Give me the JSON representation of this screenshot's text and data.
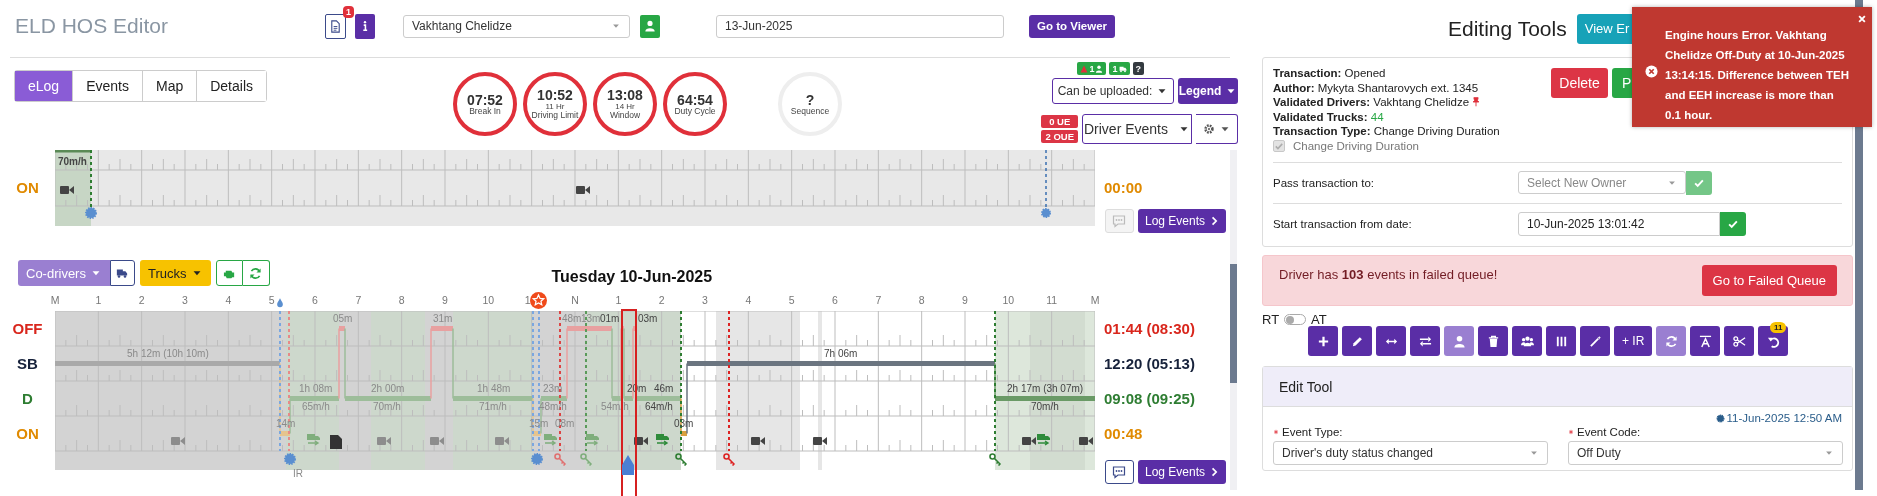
{
  "header": {
    "title": "ELD HOS Editor",
    "doc_badge": "1",
    "driver_select": "Vakhtang Chelidze",
    "date_field": "13-Jun-2025",
    "viewer_button": "Go to Viewer"
  },
  "tabs": [
    {
      "label": "eLog",
      "selected": true
    },
    {
      "label": "Events",
      "selected": false
    },
    {
      "label": "Map",
      "selected": false
    },
    {
      "label": "Details",
      "selected": false
    }
  ],
  "timers": [
    {
      "value": "07:52",
      "label": "Break In",
      "kind": "violation"
    },
    {
      "value": "10:52",
      "caption": "11 Hr",
      "label": "Driving Limit",
      "kind": "violation"
    },
    {
      "value": "13:08",
      "caption": "14 Hr",
      "label": "Window",
      "kind": "violation"
    },
    {
      "value": "64:54",
      "label": "Duty Cycle",
      "kind": "violation"
    },
    {
      "value": "?",
      "label": "Sequence",
      "kind": "pending"
    }
  ],
  "upload": {
    "badges": [
      {
        "text": "1",
        "kind": "driver"
      },
      {
        "text": "1",
        "kind": "truck"
      },
      {
        "text": "?",
        "kind": "help"
      }
    ],
    "dropdown": "Can be uploaded:",
    "legend_button": "Legend"
  },
  "ue_badges": [
    "0 UE",
    "2 OUE"
  ],
  "events_dropdown": "Driver Events",
  "previous_day": {
    "row_label": "ON",
    "speed_label": "70m/h",
    "total": "00:00",
    "log_button": "Log Events",
    "comment_disabled": true
  },
  "day": {
    "toolbar": {
      "codrivers": "Co-drivers",
      "trucks": "Trucks"
    },
    "title": "Tuesday 10-Jun-2025",
    "hours": [
      "M",
      "1",
      "2",
      "3",
      "4",
      "5",
      "6",
      "7",
      "8",
      "9",
      "10",
      "1",
      "N",
      "1",
      "2",
      "3",
      "4",
      "5",
      "6",
      "7",
      "8",
      "9",
      "10",
      "11",
      "M"
    ],
    "rows": [
      {
        "label": "OFF",
        "total": "01:44 (08:30)",
        "color": "#d9261c"
      },
      {
        "label": "SB",
        "total": "12:20 (05:13)",
        "color": "#17223b"
      },
      {
        "label": "D",
        "total": "09:08 (09:25)",
        "color": "#2e7d32"
      },
      {
        "label": "ON",
        "total": "00:48",
        "color": "#e08a00"
      }
    ],
    "labels": [
      {
        "text": "5h 12m (10h 10m)",
        "faded": true
      },
      {
        "text": "05m",
        "faded": true
      },
      {
        "text": "31m",
        "faded": true
      },
      {
        "text": "48m",
        "faded": true
      },
      {
        "text": "13m",
        "faded": true
      },
      {
        "text": "01m",
        "faded": false
      },
      {
        "text": "03m",
        "faded": false
      },
      {
        "text": "1h 08m",
        "faded": true
      },
      {
        "text": "2h 00m",
        "faded": true
      },
      {
        "text": "1h 48m",
        "faded": true
      },
      {
        "text": "23m",
        "faded": true
      },
      {
        "text": "20m",
        "faded": false
      },
      {
        "text": "46m",
        "faded": false
      },
      {
        "text": "65m/h",
        "faded": true
      },
      {
        "text": "70m/h",
        "faded": true
      },
      {
        "text": "71m/h",
        "faded": true
      },
      {
        "text": "48m/h",
        "faded": true
      },
      {
        "text": "54m/h",
        "faded": true
      },
      {
        "text": "64m/h",
        "faded": false
      },
      {
        "text": "14m",
        "faded": true
      },
      {
        "text": "15m",
        "faded": true
      },
      {
        "text": "08m",
        "faded": true
      },
      {
        "text": "03m",
        "faded": false
      },
      {
        "text": "7h 06m",
        "faded": false
      },
      {
        "text": "2h 17m (3h 07m)",
        "faded": false
      },
      {
        "text": "70m/h",
        "faded": false
      },
      {
        "text": "IR",
        "faded": true
      }
    ],
    "log_button": "Log Events",
    "comment_disabled": false
  },
  "editing": {
    "title": "Editing Tools",
    "view_button": "View Er",
    "lines": [
      {
        "label": "Transaction:",
        "value": "Opened",
        "pinned": false,
        "highlight": false
      },
      {
        "label": "Author:",
        "value": "Mykyta Shantarovych ext. 1345",
        "pinned": false,
        "highlight": false
      },
      {
        "label": "Validated Drivers:",
        "value": "Vakhtang Chelidze",
        "pinned": true,
        "highlight": false
      },
      {
        "label": "Validated Trucks:",
        "value": "44",
        "pinned": false,
        "highlight": true
      },
      {
        "label": "Transaction Type:",
        "value": "Change Driving Duration",
        "pinned": false,
        "highlight": false
      }
    ],
    "checkbox": {
      "label": "Change Driving Duration",
      "checked": true,
      "disabled": true
    },
    "delete_button": "Delete",
    "second_button": "P",
    "pass_to": {
      "label": "Pass transaction to:",
      "placeholder": "Select New Owner",
      "disabled": true
    },
    "start_from": {
      "label": "Start transaction from date:",
      "value": "10-Jun-2025 13:01:42"
    }
  },
  "failed_queue": {
    "message": "Driver has **103** events in failed queue!",
    "button": "Go to Failed Queue"
  },
  "mode_toggle": {
    "left": "RT",
    "right": "AT",
    "on": false
  },
  "tools": [
    {
      "kind": "plus",
      "disabled": false
    },
    {
      "kind": "pencil",
      "disabled": false
    },
    {
      "kind": "arrows",
      "disabled": false
    },
    {
      "kind": "swap",
      "disabled": false
    },
    {
      "kind": "user",
      "disabled": true
    },
    {
      "kind": "trash",
      "disabled": false
    },
    {
      "kind": "users",
      "disabled": false
    },
    {
      "kind": "columns",
      "disabled": false
    },
    {
      "kind": "wand",
      "disabled": false
    },
    {
      "kind": "text",
      "label": "+ IR",
      "disabled": false
    },
    {
      "kind": "refresh",
      "disabled": true
    },
    {
      "kind": "text-height",
      "disabled": false
    },
    {
      "kind": "scissors",
      "disabled": false
    },
    {
      "kind": "undo",
      "badge": "11",
      "disabled": false
    }
  ],
  "edit_tool": {
    "title": "Edit Tool",
    "timestamp": "11-Jun-2025 12:50 AM",
    "fields": [
      {
        "label": "Event Type:",
        "value": "Driver's duty status changed",
        "required": true
      },
      {
        "label": "Event Code:",
        "value": "Off Duty",
        "required": true
      }
    ]
  },
  "toast": {
    "message": "Engine hours Error. Vakhtang Chelidze Off-Duty at 10-Jun-2025 13:14:15. Difference between TEH and EEH increase is more than 0.1 hour."
  }
}
